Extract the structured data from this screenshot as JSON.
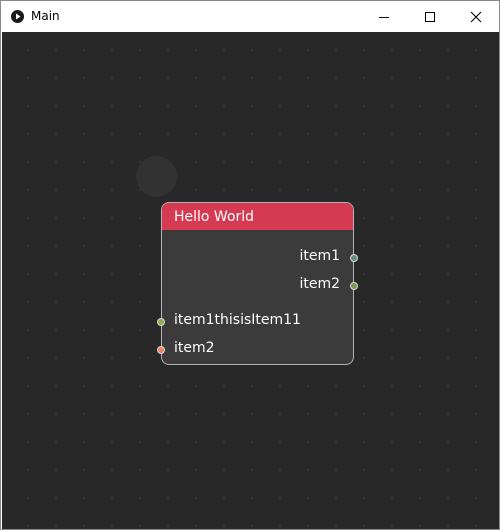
{
  "window": {
    "title": "Main"
  },
  "node": {
    "title": "Hello World",
    "header_color": "#d63a52",
    "outputs": [
      {
        "label": "item1",
        "color": "#5f8f7c"
      },
      {
        "label": "item2",
        "color": "#7a9a4f"
      }
    ],
    "inputs": [
      {
        "label": "item1thisisItem11",
        "color": "#8fae4a"
      },
      {
        "label": "item2",
        "color": "#f08262"
      }
    ]
  },
  "colors": {
    "canvas_bg": "#282828",
    "node_bg": "#3b3b3b",
    "node_border": "#b4b4b4"
  },
  "icons": {
    "app": "play-circle-icon",
    "minimize": "minimize-icon",
    "maximize": "maximize-icon",
    "close": "close-icon"
  }
}
